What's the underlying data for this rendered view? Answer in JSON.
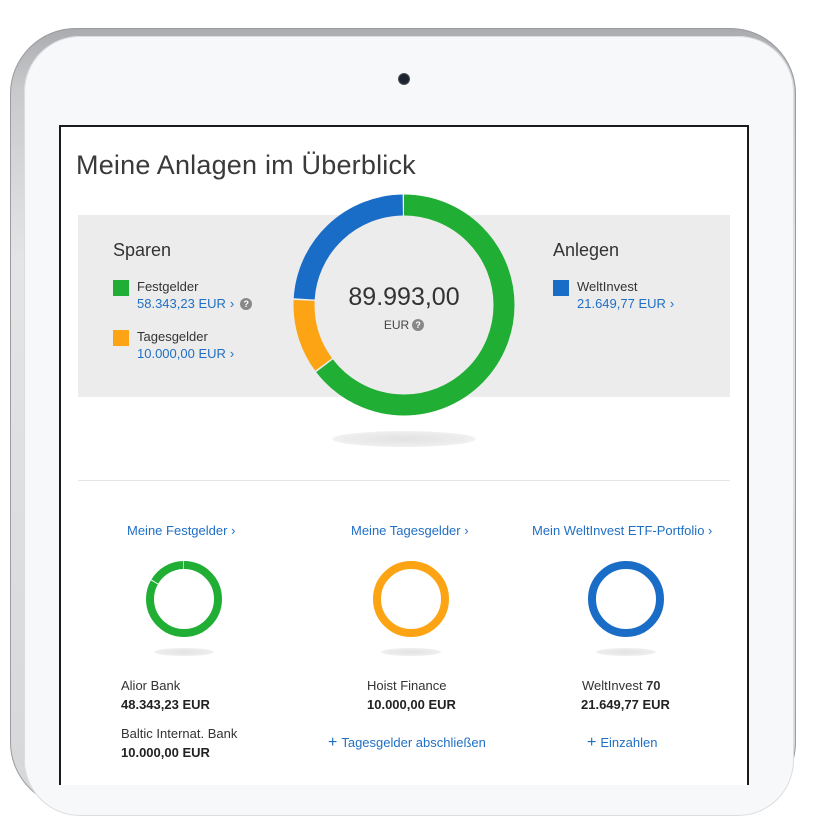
{
  "page_title": "Meine Anlagen im Überblick",
  "colors": {
    "green": "#21ae34",
    "orange": "#fca413",
    "blue": "#1a6dc7",
    "link": "#1f6fc4"
  },
  "summary": {
    "sparen": {
      "title": "Sparen",
      "items": [
        {
          "label": "Festgelder",
          "amount": "58.343,23 EUR",
          "color": "#21ae34",
          "help": true
        },
        {
          "label": "Tagesgelder",
          "amount": "10.000,00 EUR",
          "color": "#fca413",
          "help": false
        }
      ]
    },
    "anlegen": {
      "title": "Anlegen",
      "items": [
        {
          "label": "WeltInvest",
          "amount": "21.649,77 EUR",
          "color": "#1a6dc7"
        }
      ]
    },
    "total": {
      "value": "89.993,00",
      "unit": "EUR"
    },
    "chart_segments": [
      {
        "name": "Festgelder",
        "value": 58343.23,
        "color": "#21ae34"
      },
      {
        "name": "Tagesgelder",
        "value": 10000.0,
        "color": "#fca413"
      },
      {
        "name": "WeltInvest",
        "value": 21649.77,
        "color": "#1a6dc7"
      }
    ]
  },
  "columns": [
    {
      "link": "Meine Festgelder",
      "color": "#21ae34",
      "ring_fraction": 0.83,
      "entries": [
        {
          "name": "Alior Bank",
          "amount": "48.343,23 EUR"
        },
        {
          "name": "Baltic Internat. Bank",
          "amount": "10.000,00 EUR"
        }
      ]
    },
    {
      "link": "Meine Tagesgelder",
      "color": "#fca413",
      "ring_fraction": 1.0,
      "entries": [
        {
          "name": "Hoist Finance",
          "amount": "10.000,00 EUR"
        }
      ],
      "action": "Tagesgelder abschließen"
    },
    {
      "link": "Mein WeltInvest ETF-Portfolio",
      "color": "#1a6dc7",
      "ring_fraction": 1.0,
      "entries": [
        {
          "name": "WeltInvest",
          "name_suffix": "70",
          "amount": "21.649,77 EUR"
        }
      ],
      "action": "Einzahlen"
    }
  ]
}
